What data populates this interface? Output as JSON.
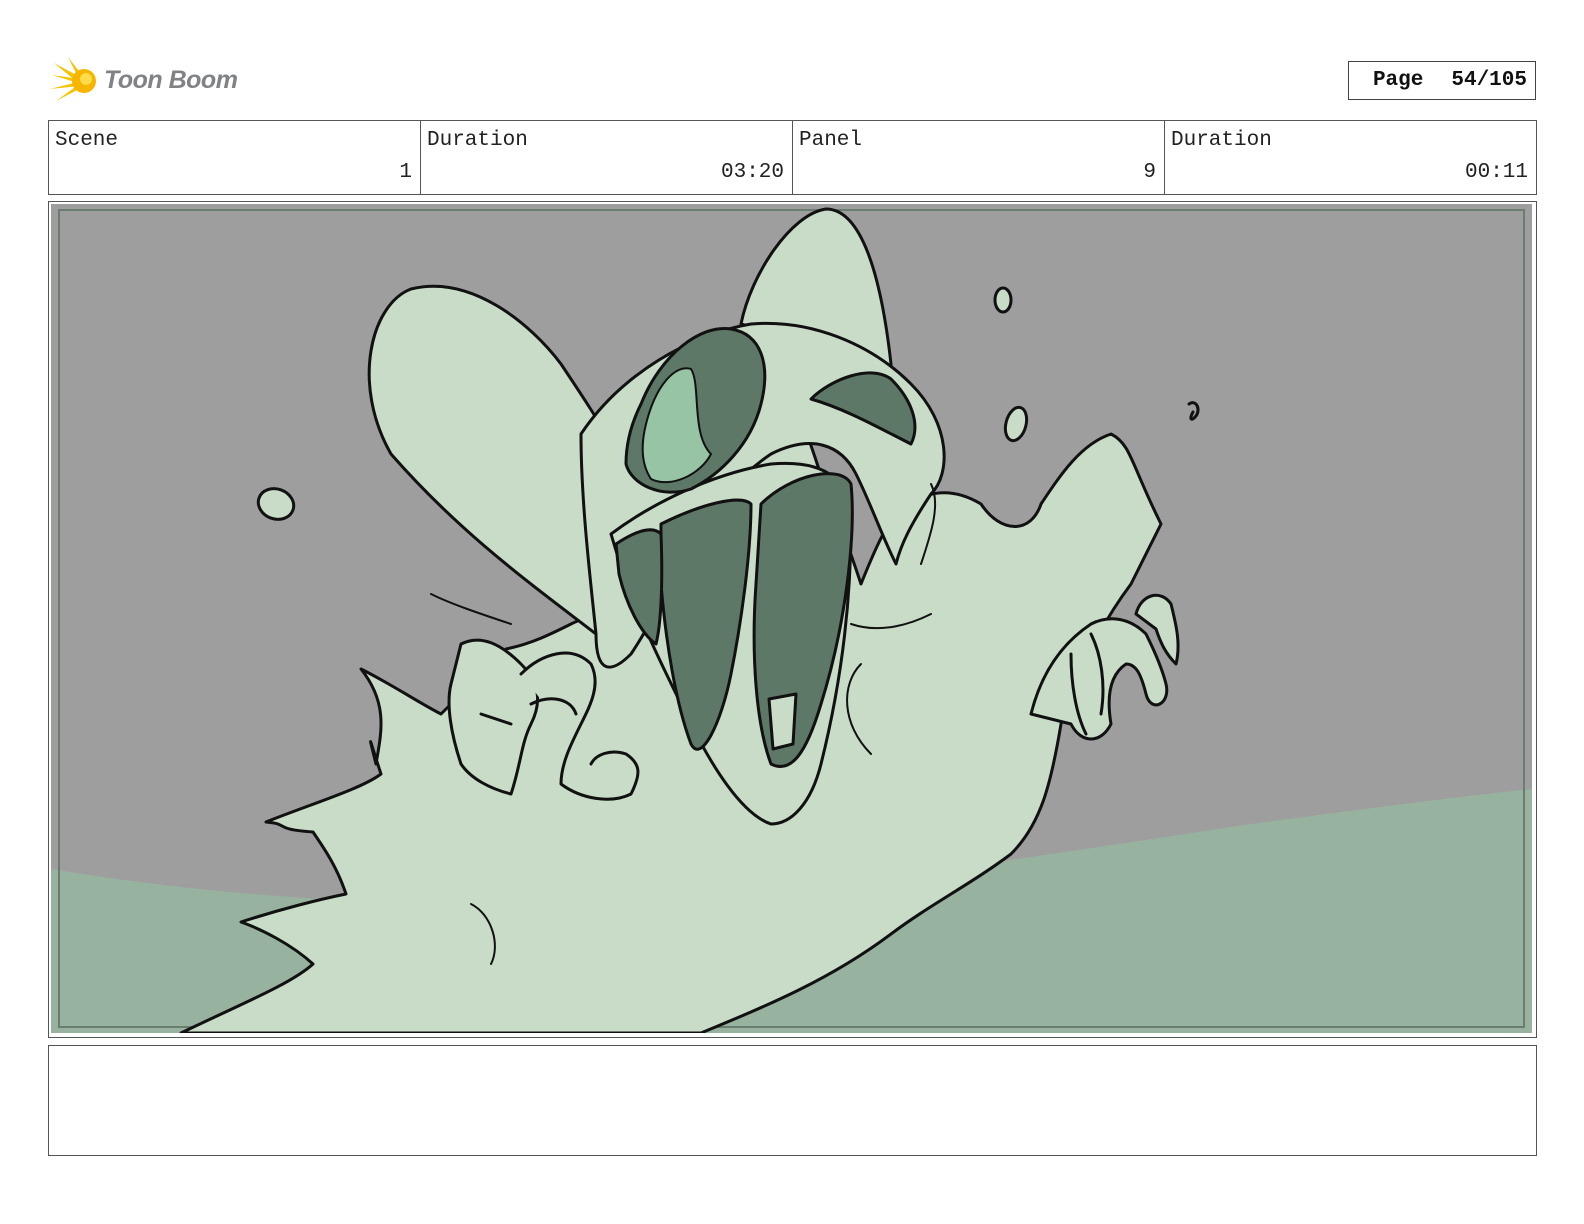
{
  "header": {
    "logo_text": "Toon Boom",
    "page_label": "Page",
    "page_value": "54/105"
  },
  "info": {
    "scene_label": "Scene",
    "scene_value": "1",
    "scene_duration_label": "Duration",
    "scene_duration_value": "03:20",
    "panel_label": "Panel",
    "panel_value": "9",
    "panel_duration_label": "Duration",
    "panel_duration_value": "00:11"
  },
  "artwork": {
    "description_icon": "screaming-ghost-bat-sketch",
    "colors": {
      "background_gray": "#9e9e9e",
      "ground_green": "#97b3a0",
      "creature_fill": "#c8dcc8",
      "shadow_fill": "#5e7868",
      "eye_fill": "#96c4a4",
      "line": "#111111"
    }
  },
  "notes": {
    "text": ""
  }
}
